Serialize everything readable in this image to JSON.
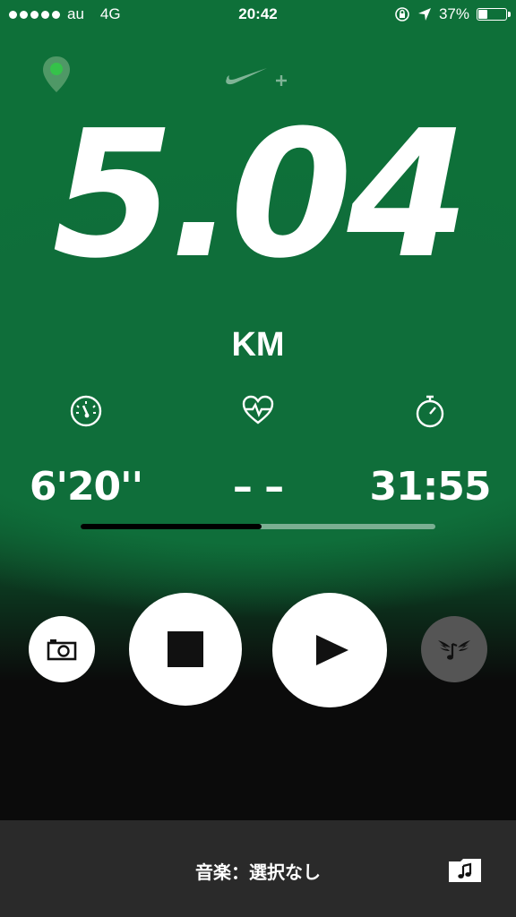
{
  "status_bar": {
    "carrier": "au",
    "network": "4G",
    "time": "20:42",
    "battery": "37%",
    "battery_level": 0.37,
    "signal_dots": 5
  },
  "header": {
    "location_icon": "location-pin-icon",
    "logo_icon": "nike-plus-swoosh-icon"
  },
  "run": {
    "distance": "5.04",
    "unit": "KM",
    "pace": "6'20''",
    "heart_rate": "– –",
    "duration": "31:55",
    "progress": 0.51
  },
  "controls": {
    "camera_icon": "camera-icon",
    "stop_icon": "stop-icon",
    "play_icon": "play-icon",
    "powersong_icon": "winged-music-note-icon"
  },
  "music": {
    "label": "音楽：選択なし",
    "icon": "music-folder-icon"
  },
  "colors": {
    "accent_green": "#0e7039",
    "background_dark": "#0b0b0b",
    "bottom_bar": "#2a2a2a",
    "pin_green": "#5fb86a"
  }
}
